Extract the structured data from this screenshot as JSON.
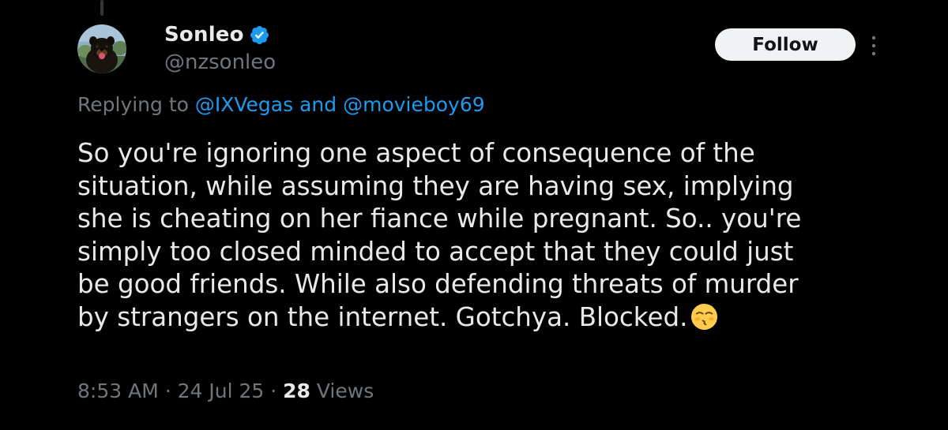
{
  "author": {
    "display_name": "Sonleo",
    "handle": "@nzsonleo",
    "verified_icon": "verified-badge-icon",
    "avatar_icon": "dog-avatar",
    "verified_color": "#1d9bf0"
  },
  "actions": {
    "follow_label": "Follow",
    "more_icon": "more-vertical-icon"
  },
  "reply_context": {
    "prefix": "Replying to ",
    "mention_1": "@IXVegas",
    "connector": " and ",
    "mention_2": "@movieboy69"
  },
  "tweet": {
    "lines": [
      "So you're ignoring one aspect of consequence of the",
      "situation, while assuming they are having sex, implying",
      "she is cheating on her fiance while pregnant. So.. you're",
      "simply too closed minded to accept that they could just",
      "be good friends. While also defending threats of murder",
      "by strangers on the internet. Gotchya. Blocked."
    ],
    "emoji": "kissing-face-with-closed-eyes-emoji"
  },
  "meta": {
    "time": "8:53 AM",
    "separator": " · ",
    "date": "24 Jul 25",
    "views_count": "28",
    "views_label": " Views"
  },
  "colors": {
    "background": "#000000",
    "primary_text": "#e7e9ea",
    "secondary_text": "#71767b",
    "link": "#1d9bf0",
    "follow_bg": "#eff3f4"
  }
}
